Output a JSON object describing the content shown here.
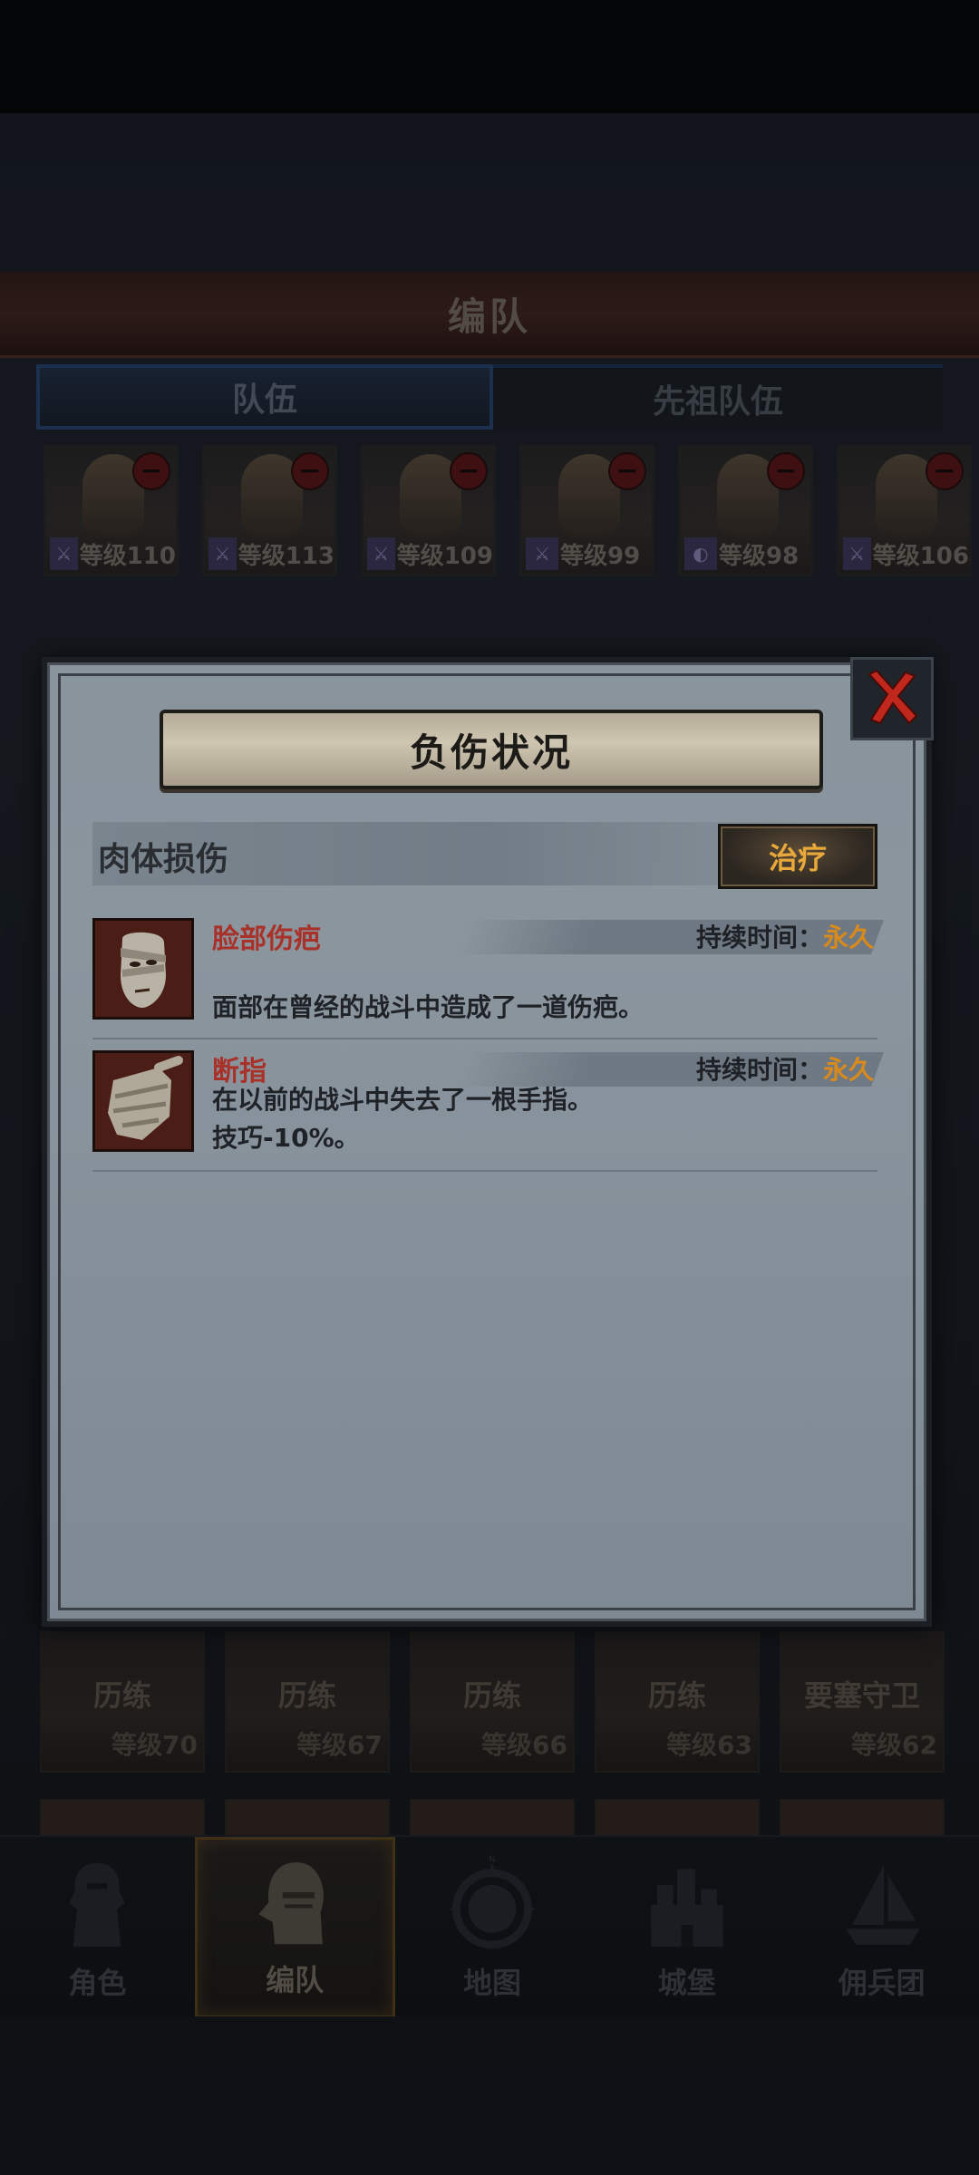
{
  "screen": {
    "title": "编队",
    "tabs": [
      "队伍",
      "先祖队伍"
    ]
  },
  "heroes": [
    {
      "level": "等级110"
    },
    {
      "level": "等级113"
    },
    {
      "level": "等级109"
    },
    {
      "level": "等级99"
    },
    {
      "level": "等级98"
    },
    {
      "level": "等级106"
    }
  ],
  "bottom_cards": [
    {
      "title": "历练",
      "level": "等级70"
    },
    {
      "title": "历练",
      "level": "等级67"
    },
    {
      "title": "历练",
      "level": "等级66"
    },
    {
      "title": "历练",
      "level": "等级63"
    },
    {
      "title": "要塞守卫",
      "level": "等级62"
    }
  ],
  "nav": [
    {
      "label": "角色",
      "icon": "knight-icon"
    },
    {
      "label": "编队",
      "icon": "helmet-icon"
    },
    {
      "label": "地图",
      "icon": "compass-icon"
    },
    {
      "label": "城堡",
      "icon": "castle-icon"
    },
    {
      "label": "佣兵团",
      "icon": "ship-icon"
    }
  ],
  "modal": {
    "title": "负伤状况",
    "section_label": "肉体损伤",
    "heal_button": "治疗",
    "duration_label": "持续时间：",
    "injuries": [
      {
        "name": "脸部伤疤",
        "duration": "永久",
        "description": "面部在曾经的战斗中造成了一道伤疤。",
        "icon": "bandaged-face-icon"
      },
      {
        "name": "断指",
        "duration": "永久",
        "description_line1": "在以前的战斗中失去了一根手指。",
        "description_line2": "技巧-10%。",
        "icon": "bandaged-hand-icon"
      }
    ]
  },
  "colors": {
    "accent_orange": "#d88a1c",
    "injury_red": "#a8322a",
    "nav_active_border": "#6a4d1c"
  }
}
